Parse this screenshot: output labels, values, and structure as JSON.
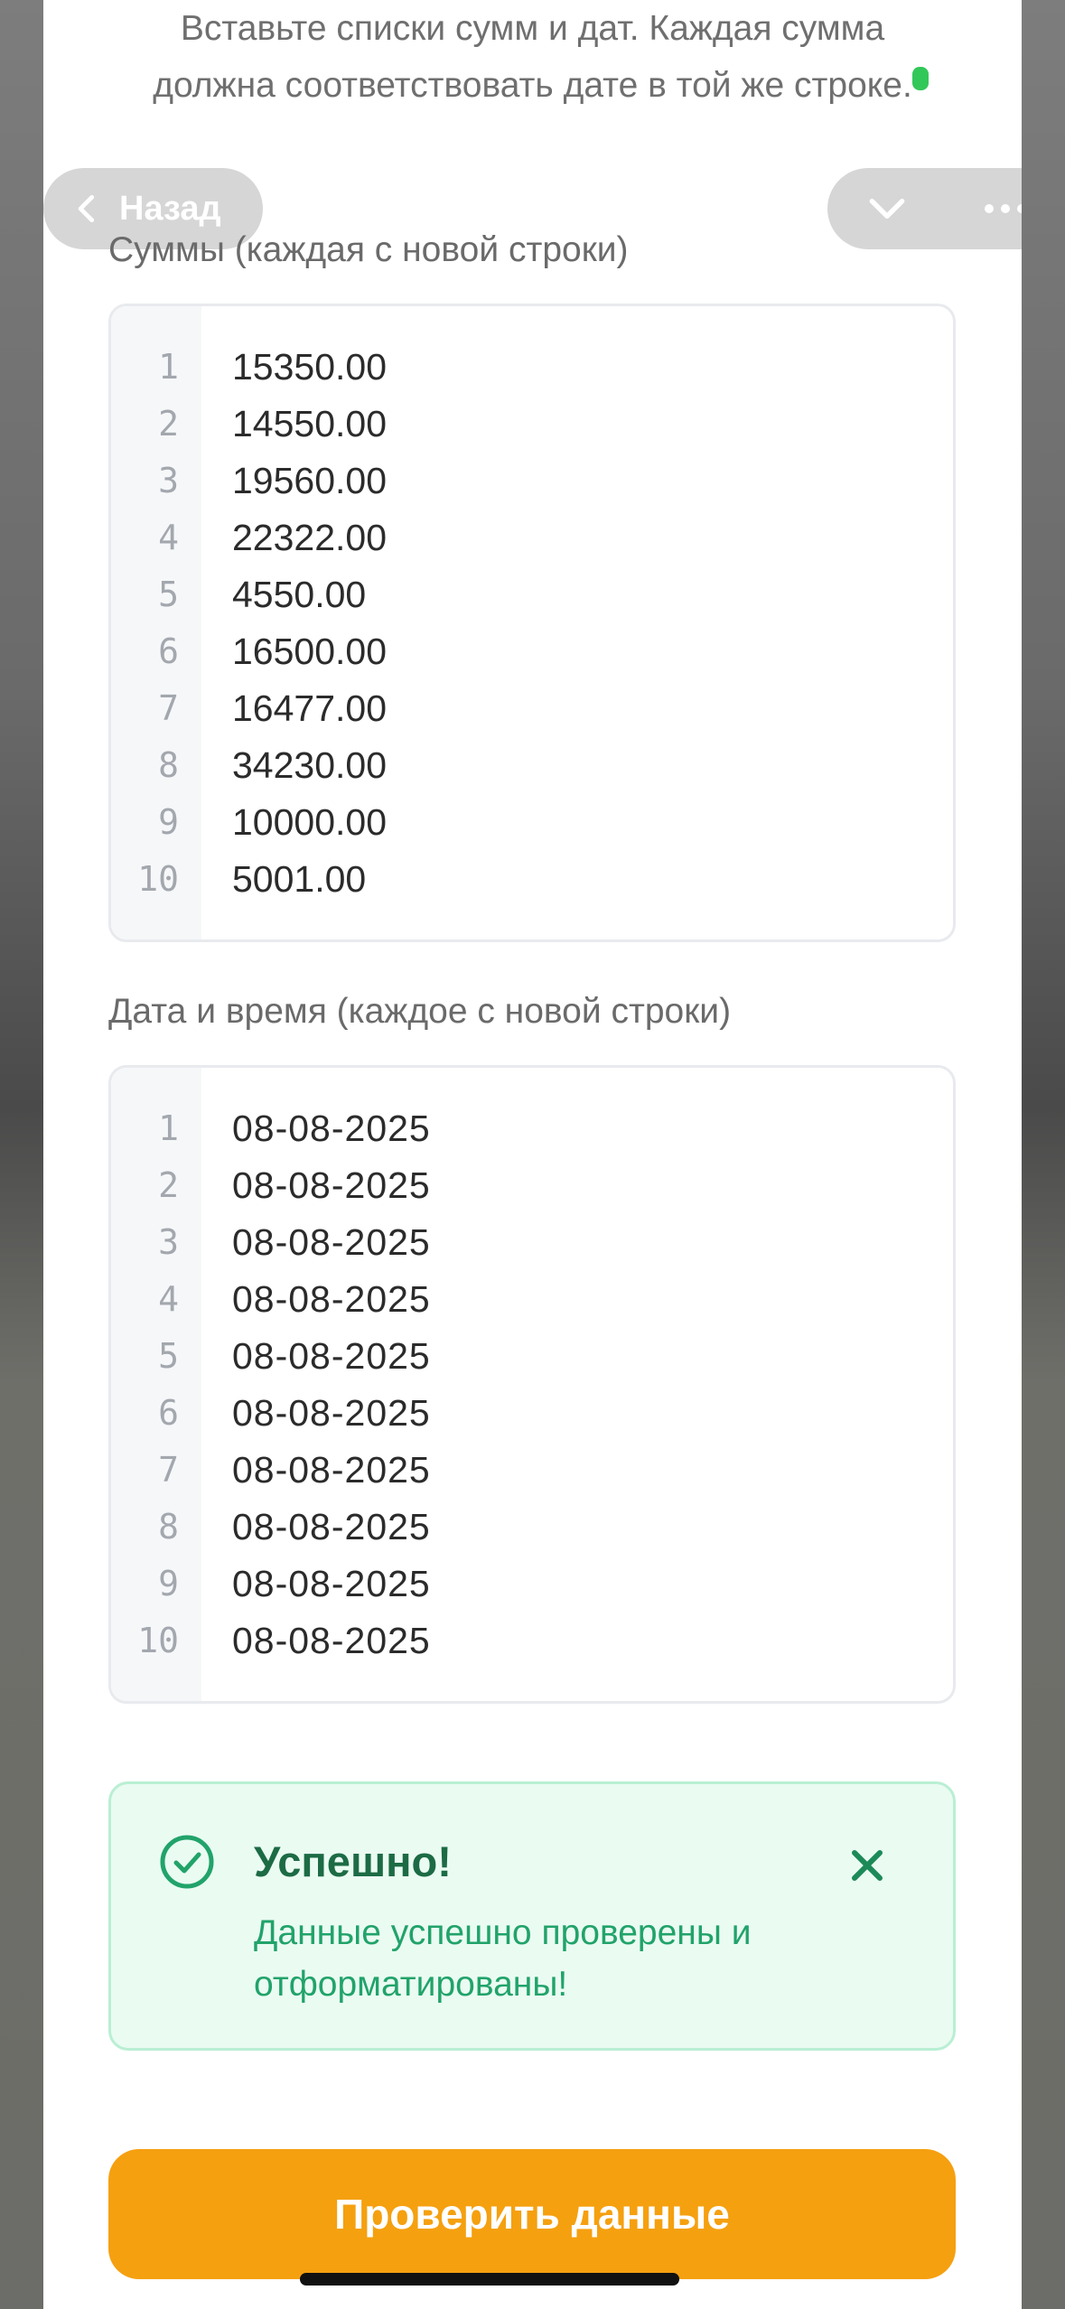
{
  "intro_text": "Вставьте списки сумм и дат. Каждая сумма должна соответствовать дате в той же строке.",
  "nav": {
    "back_label": "Назад",
    "icons": {
      "back": "chevron-left-icon",
      "collapse": "chevron-down-icon",
      "more": "more-icon"
    }
  },
  "sums": {
    "label": "Суммы (каждая с новой строки)",
    "lines": [
      {
        "n": "1",
        "v": "15350.00"
      },
      {
        "n": "2",
        "v": "14550.00"
      },
      {
        "n": "3",
        "v": "19560.00"
      },
      {
        "n": "4",
        "v": "22322.00"
      },
      {
        "n": "5",
        "v": "4550.00"
      },
      {
        "n": "6",
        "v": "16500.00"
      },
      {
        "n": "7",
        "v": "16477.00"
      },
      {
        "n": "8",
        "v": "34230.00"
      },
      {
        "n": "9",
        "v": "10000.00"
      },
      {
        "n": "10",
        "v": "5001.00"
      }
    ]
  },
  "dates": {
    "label": "Дата и время (каждое с новой строки)",
    "lines": [
      {
        "n": "1",
        "v": "08-08-2025"
      },
      {
        "n": "2",
        "v": "08-08-2025"
      },
      {
        "n": "3",
        "v": "08-08-2025"
      },
      {
        "n": "4",
        "v": "08-08-2025"
      },
      {
        "n": "5",
        "v": "08-08-2025"
      },
      {
        "n": "6",
        "v": "08-08-2025"
      },
      {
        "n": "7",
        "v": "08-08-2025"
      },
      {
        "n": "8",
        "v": "08-08-2025"
      },
      {
        "n": "9",
        "v": "08-08-2025"
      },
      {
        "n": "10",
        "v": "08-08-2025"
      }
    ]
  },
  "toast": {
    "title": "Успешно!",
    "message": "Данные успешно проверены и отформатированы!",
    "icons": {
      "status": "check-circle-icon",
      "close": "close-icon"
    },
    "colors": {
      "bg": "#eafbf2",
      "border": "#b9efd3",
      "accent": "#21a36a"
    }
  },
  "primary_button": {
    "label": "Проверить данные",
    "color": "#f5a00f"
  }
}
